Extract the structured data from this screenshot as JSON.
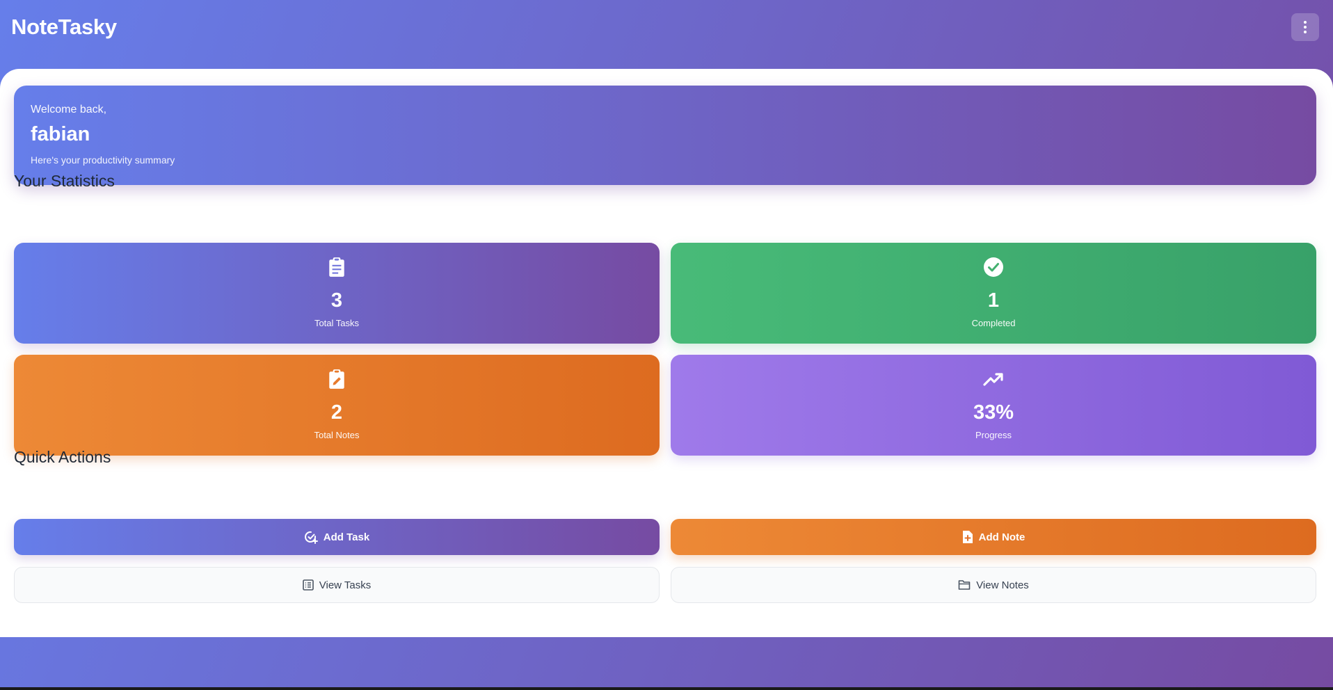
{
  "app": {
    "title": "NoteTasky"
  },
  "welcome": {
    "greeting": "Welcome back,",
    "username": "fabian",
    "subtitle": "Here's your productivity summary"
  },
  "stats": {
    "heading": "Your Statistics",
    "items": [
      {
        "value": "3",
        "label": "Total Tasks",
        "icon": "clipboard-list-icon"
      },
      {
        "value": "1",
        "label": "Completed",
        "icon": "check-circle-icon"
      },
      {
        "value": "2",
        "label": "Total Notes",
        "icon": "clipboard-edit-icon"
      },
      {
        "value": "33%",
        "label": "Progress",
        "icon": "trending-up-icon"
      }
    ]
  },
  "quick_actions": {
    "heading": "Quick Actions",
    "add_task": "Add Task",
    "add_note": "Add Note",
    "view_tasks": "View Tasks",
    "view_notes": "View Notes"
  },
  "colors": {
    "primary_gradient": [
      "#667eea",
      "#764ba2"
    ],
    "success_gradient": [
      "#48bb78",
      "#38a169"
    ],
    "warning_gradient": [
      "#ed8936",
      "#dd6b20"
    ],
    "purple_gradient": [
      "#9f7aea",
      "#805ad5"
    ]
  }
}
